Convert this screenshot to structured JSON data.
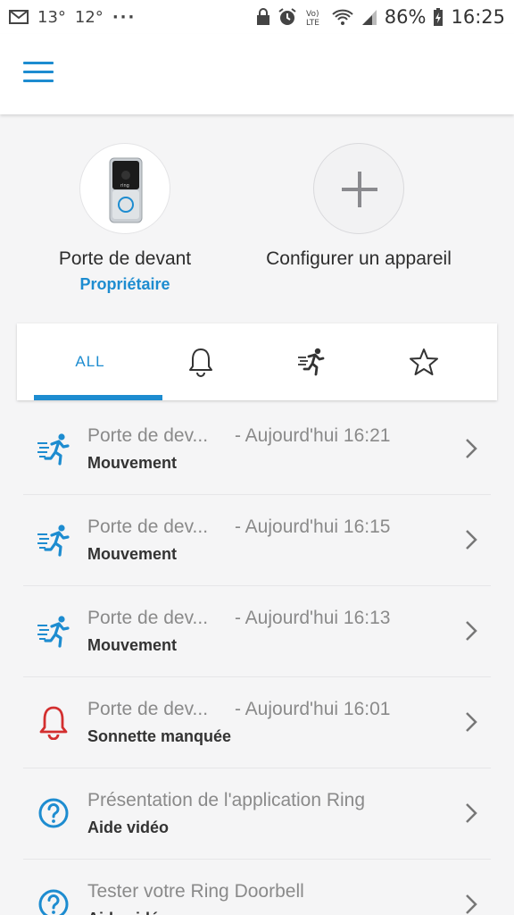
{
  "status_bar": {
    "temp1": "13°",
    "temp2": "12°",
    "dots": "···",
    "battery": "86%",
    "time": "16:25"
  },
  "header": {
    "menu_icon": "hamburger-menu-icon"
  },
  "devices": [
    {
      "name": "Porte de devant",
      "role": "Propriétaire",
      "icon": "doorbell-device-image"
    },
    {
      "name": "Configurer un appareil",
      "icon": "plus-icon"
    }
  ],
  "tabs": {
    "all_label": "ALL",
    "selected": "ALL",
    "icons": [
      "bell-icon",
      "motion-runner-icon",
      "star-icon"
    ]
  },
  "events": [
    {
      "device": "Porte de dev...",
      "time": "- Aujourd'hui 16:21",
      "type": "Mouvement",
      "icon": "motion-icon"
    },
    {
      "device": "Porte de dev...",
      "time": "- Aujourd'hui 16:15",
      "type": "Mouvement",
      "icon": "motion-icon"
    },
    {
      "device": "Porte de dev...",
      "time": "- Aujourd'hui 16:13",
      "type": "Mouvement",
      "icon": "motion-icon"
    },
    {
      "device": "Porte de dev...",
      "time": "- Aujourd'hui 16:01",
      "type": "Sonnette manquée",
      "icon": "bell-icon"
    },
    {
      "device": "Présentation de l'application Ring",
      "time": "",
      "type": "Aide vidéo",
      "icon": "help-icon"
    },
    {
      "device": "Tester votre Ring Doorbell",
      "time": "",
      "type": "Aide vidéo",
      "icon": "help-icon"
    }
  ],
  "colors": {
    "accent": "#1d8cd0",
    "alert": "#d32f2f",
    "background": "#f5f5f6"
  }
}
